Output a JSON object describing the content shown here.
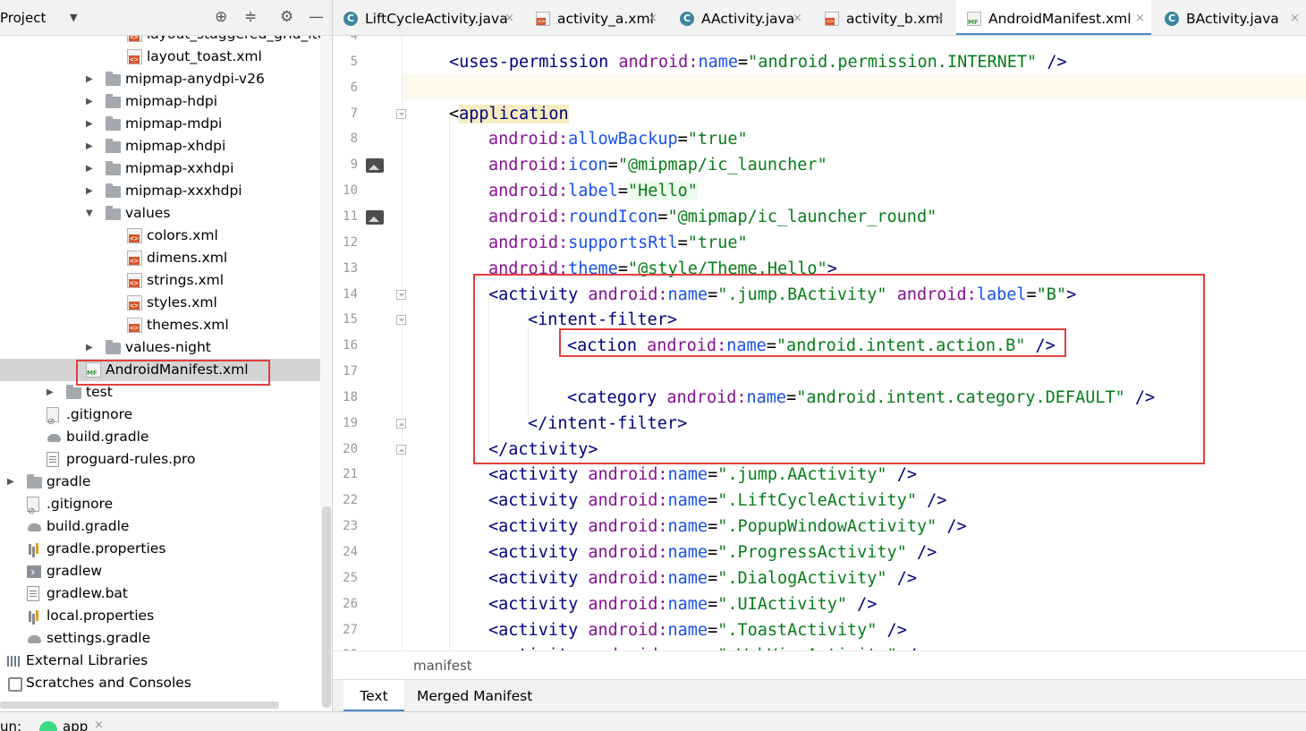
{
  "project_panel": {
    "title": "Project",
    "dropdown_glyph": "▼",
    "tree": [
      {
        "label": "layout_staggered_grid_item.",
        "icon": "xml",
        "level": 2
      },
      {
        "label": "layout_toast.xml",
        "icon": "xml",
        "level": 2
      },
      {
        "label": "mipmap-anydpi-v26",
        "icon": "folder",
        "level": 1,
        "arrow": "▶"
      },
      {
        "label": "mipmap-hdpi",
        "icon": "folder",
        "level": 1,
        "arrow": "▶"
      },
      {
        "label": "mipmap-mdpi",
        "icon": "folder",
        "level": 1,
        "arrow": "▶"
      },
      {
        "label": "mipmap-xhdpi",
        "icon": "folder",
        "level": 1,
        "arrow": "▶"
      },
      {
        "label": "mipmap-xxhdpi",
        "icon": "folder",
        "level": 1,
        "arrow": "▶"
      },
      {
        "label": "mipmap-xxxhdpi",
        "icon": "folder",
        "level": 1,
        "arrow": "▶"
      },
      {
        "label": "values",
        "icon": "folder",
        "level": 1,
        "arrow": "▼"
      },
      {
        "label": "colors.xml",
        "icon": "xml",
        "level": 2
      },
      {
        "label": "dimens.xml",
        "icon": "xml",
        "level": 2
      },
      {
        "label": "strings.xml",
        "icon": "xml",
        "level": 2
      },
      {
        "label": "styles.xml",
        "icon": "xml",
        "level": 2
      },
      {
        "label": "themes.xml",
        "icon": "xml",
        "level": 2
      },
      {
        "label": "values-night",
        "icon": "folder",
        "level": 1,
        "arrow": "▶"
      },
      {
        "label": "AndroidManifest.xml",
        "icon": "mf",
        "level": 0,
        "selected": true
      },
      {
        "label": "test",
        "icon": "folder",
        "level": -1,
        "arrow": "▶"
      },
      {
        "label": ".gitignore",
        "icon": "gitig",
        "level": -2
      },
      {
        "label": "build.gradle",
        "icon": "gradle",
        "level": -2
      },
      {
        "label": "proguard-rules.pro",
        "icon": "file",
        "level": -2
      },
      {
        "label": "gradle",
        "icon": "folder",
        "level": -3,
        "arrow": "▶"
      },
      {
        "label": ".gitignore",
        "icon": "gitig",
        "level": -4
      },
      {
        "label": "build.gradle",
        "icon": "gradle",
        "level": -4
      },
      {
        "label": "gradle.properties",
        "icon": "props",
        "level": -4
      },
      {
        "label": "gradlew",
        "icon": "term",
        "level": -4
      },
      {
        "label": "gradlew.bat",
        "icon": "file",
        "level": -4
      },
      {
        "label": "local.properties",
        "icon": "props",
        "level": -4
      },
      {
        "label": "settings.gradle",
        "icon": "gradle",
        "level": -4
      },
      {
        "label": "External Libraries",
        "icon": "bars",
        "level": -5
      },
      {
        "label": "Scratches and Consoles",
        "icon": "scratch",
        "level": -5
      }
    ]
  },
  "editor_tabs": [
    {
      "label": "LiftCycleActivity.java",
      "icon": "java",
      "active": false
    },
    {
      "label": "activity_a.xml",
      "icon": "xml",
      "active": false
    },
    {
      "label": "AActivity.java",
      "icon": "java",
      "active": false
    },
    {
      "label": "activity_b.xml",
      "icon": "xml",
      "active": false
    },
    {
      "label": "AndroidManifest.xml",
      "icon": "mf",
      "active": true
    },
    {
      "label": "BActivity.java",
      "icon": "java",
      "active": false
    }
  ],
  "tab_close_glyph": "×",
  "code_lines": [
    {
      "n": "4",
      "indent": 1,
      "tokens": []
    },
    {
      "n": "5",
      "indent": 1,
      "tokens": [
        [
          "tag",
          "<uses-permission "
        ],
        [
          "ns",
          "android:"
        ],
        [
          "attr",
          "name"
        ],
        [
          "p",
          "="
        ],
        [
          "val",
          "\"android.permission.INTERNET\""
        ],
        [
          "tag",
          " />"
        ]
      ]
    },
    {
      "n": "6",
      "indent": 1,
      "tokens": []
    },
    {
      "n": "7",
      "indent": 1,
      "tokens": [
        [
          "p",
          "<"
        ],
        [
          "tag",
          "application",
          "hl-tag"
        ]
      ]
    },
    {
      "n": "8",
      "indent": 2,
      "tokens": [
        [
          "ns",
          "android:"
        ],
        [
          "attr",
          "allowBackup"
        ],
        [
          "p",
          "="
        ],
        [
          "val",
          "\"true\""
        ]
      ]
    },
    {
      "n": "9",
      "indent": 2,
      "tokens": [
        [
          "ns",
          "android:"
        ],
        [
          "attr",
          "icon"
        ],
        [
          "p",
          "="
        ],
        [
          "val",
          "\"@mipmap/ic_launcher\""
        ]
      ]
    },
    {
      "n": "10",
      "indent": 2,
      "tokens": [
        [
          "ns",
          "android:"
        ],
        [
          "attr",
          "label"
        ],
        [
          "p",
          "="
        ],
        [
          "val",
          "\"Hello\"",
          "hl-label"
        ]
      ]
    },
    {
      "n": "11",
      "indent": 2,
      "tokens": [
        [
          "ns",
          "android:"
        ],
        [
          "attr",
          "roundIcon"
        ],
        [
          "p",
          "="
        ],
        [
          "val",
          "\"@mipmap/ic_launcher_round\""
        ]
      ]
    },
    {
      "n": "12",
      "indent": 2,
      "tokens": [
        [
          "ns",
          "android:"
        ],
        [
          "attr",
          "supportsRtl"
        ],
        [
          "p",
          "="
        ],
        [
          "val",
          "\"true\""
        ]
      ]
    },
    {
      "n": "13",
      "indent": 2,
      "tokens": [
        [
          "ns",
          "android:"
        ],
        [
          "attr",
          "theme"
        ],
        [
          "p",
          "="
        ],
        [
          "val",
          "\"@style/Theme.Hello\""
        ],
        [
          "tag",
          ">"
        ]
      ]
    },
    {
      "n": "14",
      "indent": 2,
      "tokens": [
        [
          "tag",
          "<activity "
        ],
        [
          "ns",
          "android:"
        ],
        [
          "attr",
          "name"
        ],
        [
          "p",
          "="
        ],
        [
          "val",
          "\".jump.BActivity\""
        ],
        [
          "p",
          " "
        ],
        [
          "ns",
          "android:"
        ],
        [
          "attr",
          "label"
        ],
        [
          "p",
          "="
        ],
        [
          "val",
          "\"B\""
        ],
        [
          "tag",
          ">"
        ]
      ]
    },
    {
      "n": "15",
      "indent": 3,
      "tokens": [
        [
          "tag",
          "<intent-filter>"
        ]
      ]
    },
    {
      "n": "16",
      "indent": 4,
      "tokens": [
        [
          "tag",
          "<action "
        ],
        [
          "ns",
          "android:"
        ],
        [
          "attr",
          "name"
        ],
        [
          "p",
          "="
        ],
        [
          "val",
          "\"android.intent.action.B\""
        ],
        [
          "tag",
          " />"
        ]
      ]
    },
    {
      "n": "17",
      "indent": 4,
      "tokens": []
    },
    {
      "n": "18",
      "indent": 4,
      "tokens": [
        [
          "tag",
          "<category "
        ],
        [
          "ns",
          "android:"
        ],
        [
          "attr",
          "name"
        ],
        [
          "p",
          "="
        ],
        [
          "val",
          "\"android.intent.category.DEFAULT\""
        ],
        [
          "tag",
          " />"
        ]
      ]
    },
    {
      "n": "19",
      "indent": 3,
      "tokens": [
        [
          "tag",
          "</intent-filter>"
        ]
      ]
    },
    {
      "n": "20",
      "indent": 2,
      "tokens": [
        [
          "tag",
          "</activity>"
        ]
      ]
    },
    {
      "n": "21",
      "indent": 2,
      "tokens": [
        [
          "tag",
          "<activity "
        ],
        [
          "ns",
          "android:"
        ],
        [
          "attr",
          "name"
        ],
        [
          "p",
          "="
        ],
        [
          "val",
          "\".jump.AActivity\""
        ],
        [
          "tag",
          " />"
        ]
      ]
    },
    {
      "n": "22",
      "indent": 2,
      "tokens": [
        [
          "tag",
          "<activity "
        ],
        [
          "ns",
          "android:"
        ],
        [
          "attr",
          "name"
        ],
        [
          "p",
          "="
        ],
        [
          "val",
          "\".LiftCycleActivity\""
        ],
        [
          "tag",
          " />"
        ]
      ]
    },
    {
      "n": "23",
      "indent": 2,
      "tokens": [
        [
          "tag",
          "<activity "
        ],
        [
          "ns",
          "android:"
        ],
        [
          "attr",
          "name"
        ],
        [
          "p",
          "="
        ],
        [
          "val",
          "\".PopupWindowActivity\""
        ],
        [
          "tag",
          " />"
        ]
      ]
    },
    {
      "n": "24",
      "indent": 2,
      "tokens": [
        [
          "tag",
          "<activity "
        ],
        [
          "ns",
          "android:"
        ],
        [
          "attr",
          "name"
        ],
        [
          "p",
          "="
        ],
        [
          "val",
          "\".ProgressActivity\""
        ],
        [
          "tag",
          " />"
        ]
      ]
    },
    {
      "n": "25",
      "indent": 2,
      "tokens": [
        [
          "tag",
          "<activity "
        ],
        [
          "ns",
          "android:"
        ],
        [
          "attr",
          "name"
        ],
        [
          "p",
          "="
        ],
        [
          "val",
          "\".DialogActivity\""
        ],
        [
          "tag",
          " />"
        ]
      ]
    },
    {
      "n": "26",
      "indent": 2,
      "tokens": [
        [
          "tag",
          "<activity "
        ],
        [
          "ns",
          "android:"
        ],
        [
          "attr",
          "name"
        ],
        [
          "p",
          "="
        ],
        [
          "val",
          "\".UIActivity\""
        ],
        [
          "tag",
          " />"
        ]
      ]
    },
    {
      "n": "27",
      "indent": 2,
      "tokens": [
        [
          "tag",
          "<activity "
        ],
        [
          "ns",
          "android:"
        ],
        [
          "attr",
          "name"
        ],
        [
          "p",
          "="
        ],
        [
          "val",
          "\".ToastActivity\""
        ],
        [
          "tag",
          " />"
        ]
      ]
    },
    {
      "n": "28",
      "indent": 2,
      "tokens": [
        [
          "tag",
          "<activity "
        ],
        [
          "ns",
          "android:"
        ],
        [
          "attr",
          "name"
        ],
        [
          "p",
          "="
        ],
        [
          "val",
          "\".WebViewActivity\""
        ],
        [
          "tag",
          " />"
        ]
      ]
    }
  ],
  "breadcrumb": "manifest",
  "bottom_tabs": [
    {
      "label": "Text",
      "active": true
    },
    {
      "label": "Merged Manifest",
      "active": false
    }
  ],
  "run_bar": {
    "label": "un:",
    "config": "app",
    "close": "×"
  },
  "colors": {
    "tag": "#000080",
    "namespace": "#871094",
    "attribute": "#1750eb",
    "value": "#067d17",
    "highlight_box": "#e33f3f",
    "accent": "#4a88c7"
  }
}
